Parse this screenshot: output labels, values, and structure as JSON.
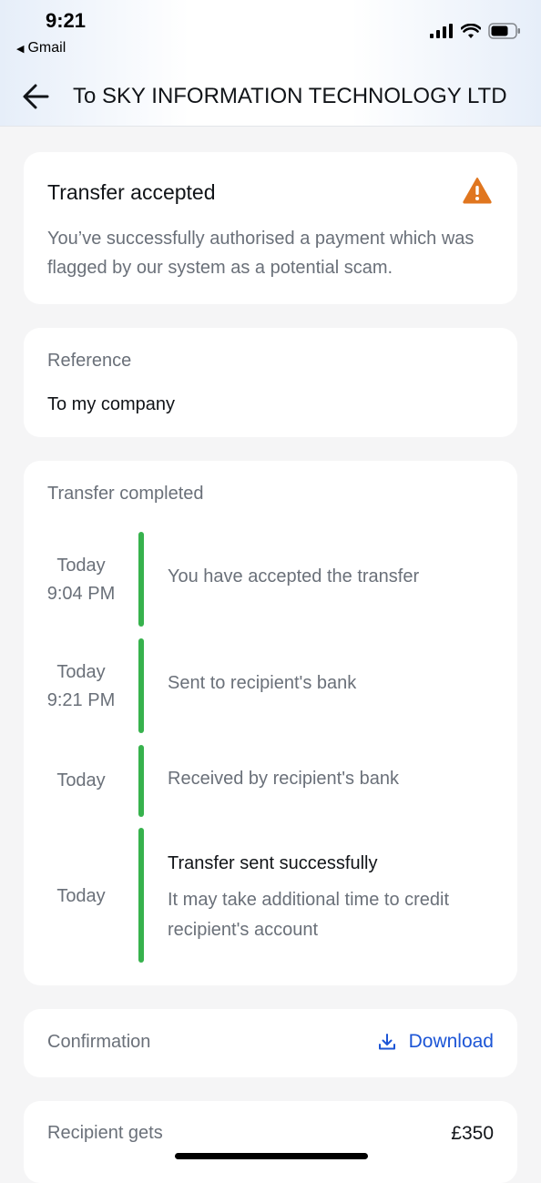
{
  "status_bar": {
    "time": "9:21",
    "back_app": "Gmail"
  },
  "nav": {
    "title": "To SKY INFORMATION TECHNOLOGY LTD"
  },
  "alert": {
    "heading": "Transfer accepted",
    "description": "You’ve successfully authorised a payment which was flagged by our system as a potential scam.",
    "icon": "warning-icon",
    "icon_color": "#e0761f"
  },
  "reference": {
    "label": "Reference",
    "value": "To my company"
  },
  "timeline": {
    "label": "Transfer completed",
    "accent_color": "#37b24d",
    "items": [
      {
        "day": "Today",
        "time": "9:04 PM",
        "text": "You have accepted the transfer"
      },
      {
        "day": "Today",
        "time": "9:21 PM",
        "text": "Sent to recipient's bank"
      },
      {
        "day": "Today",
        "time": "",
        "text": "Received by recipient's bank"
      },
      {
        "day": "Today",
        "time": "",
        "title": "Transfer sent successfully",
        "text": "It may take additional time to credit recipient's account"
      }
    ]
  },
  "confirmation": {
    "label": "Confirmation",
    "download_label": "Download",
    "link_color": "#1c55d6"
  },
  "recipient": {
    "label": "Recipient gets",
    "amount": "£350"
  }
}
